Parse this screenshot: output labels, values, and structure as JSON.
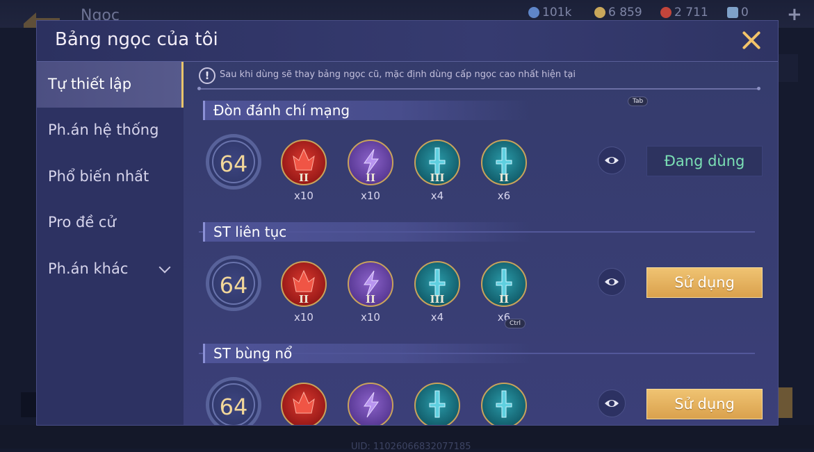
{
  "background": {
    "page_title": "Ngọc",
    "uid": "UID: 11026066832077185",
    "currencies": [
      {
        "value": "101k",
        "color": "#5f86c9",
        "icon": "gem-currency-icon"
      },
      {
        "value": "6 859",
        "color": "#c9a75a",
        "icon": "gold-coin-icon"
      },
      {
        "value": "2 711",
        "color": "#c2453b",
        "icon": "ruby-icon"
      },
      {
        "value": "0",
        "color": "#7fa2c9",
        "icon": "ticket-icon"
      }
    ],
    "plus_label": "+"
  },
  "modal": {
    "title": "Bảng ngọc của tôi",
    "close_icon": "close-icon"
  },
  "sidebar": {
    "items": [
      {
        "label": "Tự thiết lập",
        "active": true
      },
      {
        "label": "Ph.án hệ thống"
      },
      {
        "label": "Phổ biến nhất"
      },
      {
        "label": "Pro đề cử"
      },
      {
        "label": "Ph.án khác",
        "has_dropdown": true
      }
    ]
  },
  "notice": {
    "icon": "!",
    "text": "Sau khi dùng sẽ thay bảng ngọc cũ, mặc định dùng cấp ngọc cao nhất hiện tại"
  },
  "hints": {
    "tab": "Tab",
    "ctrl": "Ctrl"
  },
  "sets": [
    {
      "name": "Đòn đánh chí mạng",
      "level": "64",
      "gems": [
        {
          "color": "red",
          "tier": "II",
          "qty": "x10"
        },
        {
          "color": "purple",
          "tier": "II",
          "qty": "x10"
        },
        {
          "color": "teal",
          "tier": "III",
          "qty": "x4"
        },
        {
          "color": "teal",
          "tier": "II",
          "qty": "x6"
        }
      ],
      "action": "Đang dùng",
      "in_use": true
    },
    {
      "name": "ST liên tục",
      "level": "64",
      "gems": [
        {
          "color": "red",
          "tier": "II",
          "qty": "x10"
        },
        {
          "color": "purple",
          "tier": "II",
          "qty": "x10"
        },
        {
          "color": "teal",
          "tier": "III",
          "qty": "x4"
        },
        {
          "color": "teal",
          "tier": "II",
          "qty": "x6"
        }
      ],
      "action": "Sử dụng",
      "in_use": false
    },
    {
      "name": "ST bùng nổ",
      "level": "64",
      "gems": [
        {
          "color": "red",
          "tier": "",
          "qty": ""
        },
        {
          "color": "purple",
          "tier": "",
          "qty": ""
        },
        {
          "color": "teal",
          "tier": "",
          "qty": ""
        },
        {
          "color": "teal",
          "tier": "",
          "qty": ""
        }
      ],
      "action": "Sử dụng",
      "in_use": false
    }
  ],
  "colors": {
    "accent_gold": "#e9c56c",
    "in_use_text": "#7be0b5",
    "button_gold": "#d9a04c"
  }
}
